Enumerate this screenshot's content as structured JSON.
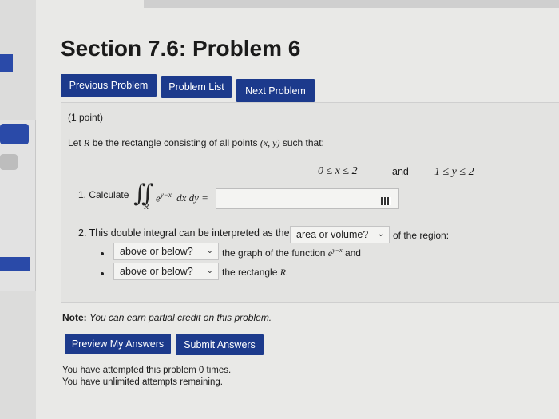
{
  "title": "Section 7.6: Problem 6",
  "nav": {
    "previous": "Previous Problem",
    "list": "Problem List",
    "next": "Next Problem"
  },
  "problem": {
    "points": "(1 point)",
    "intro_before": "Let",
    "intro_var": "R",
    "intro_mid": "be the rectangle consisting of all points",
    "intro_point": "(x, y)",
    "intro_after": "such that:",
    "constraint_x": "0 ≤ x ≤ 2",
    "and_label": "and",
    "constraint_y": "1 ≤ y ≤ 2",
    "q1_label": "1. Calculate",
    "integral_sub": "R",
    "integrand": "e",
    "exponent": "y−x",
    "differentials": "dx dy =",
    "answer_value": "",
    "q2_text": "2. This double integral can be interpreted as the",
    "q2_select": "area or volume?",
    "q2_after": "of the region:",
    "b1_select": "above or below?",
    "b1_text": "the graph of the function",
    "b1_func": "e",
    "b1_exp": "y−x",
    "b1_and": "and",
    "b2_select": "above or below?",
    "b2_text": "the rectangle",
    "b2_var": "R."
  },
  "note": {
    "label": "Note:",
    "text": "You can earn partial credit on this problem."
  },
  "actions": {
    "preview": "Preview My Answers",
    "submit": "Submit Answers"
  },
  "status": {
    "attempted": "You have attempted this problem 0 times.",
    "remaining": "You have unlimited attempts remaining."
  },
  "colors": {
    "button": "#1c3a8c",
    "accent": "#2a4aa8"
  }
}
